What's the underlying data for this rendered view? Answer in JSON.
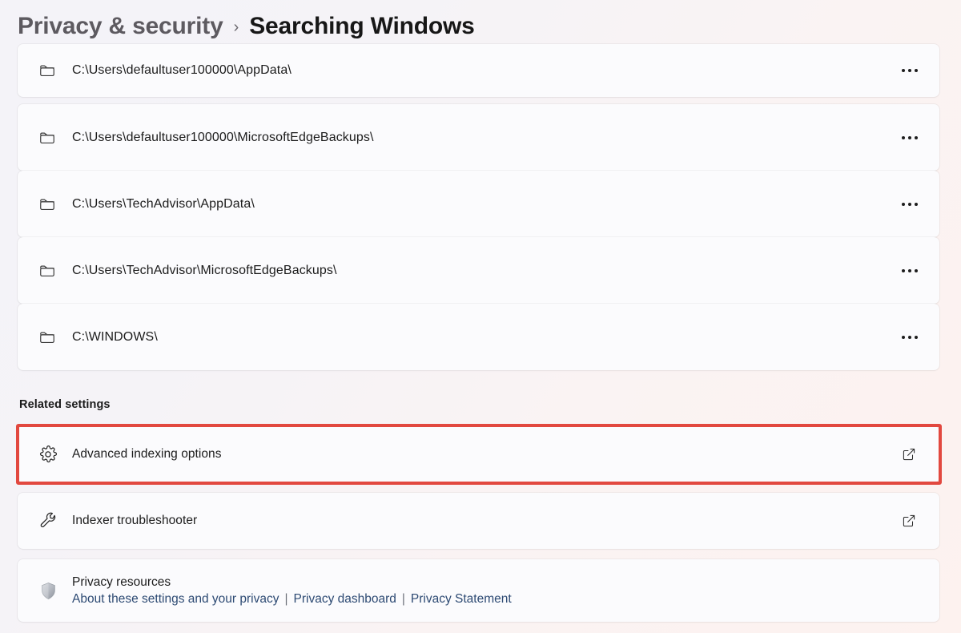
{
  "header": {
    "parent": "Privacy & security",
    "separator": "›",
    "current": "Searching Windows"
  },
  "excluded_folders": {
    "rows": [
      {
        "path": "C:\\Users\\defaultuser100000\\AppData\\",
        "icon": "folder-icon",
        "more_label": "•••"
      },
      {
        "path": "C:\\Users\\defaultuser100000\\MicrosoftEdgeBackups\\",
        "icon": "folder-icon",
        "more_label": "•••"
      },
      {
        "path": "C:\\Users\\TechAdvisor\\AppData\\",
        "icon": "folder-icon",
        "more_label": "•••"
      },
      {
        "path": "C:\\Users\\TechAdvisor\\MicrosoftEdgeBackups\\",
        "icon": "folder-icon",
        "more_label": "•••"
      },
      {
        "path": "C:\\WINDOWS\\",
        "icon": "folder-icon",
        "more_label": "•••"
      }
    ]
  },
  "related_settings": {
    "heading": "Related settings",
    "items": [
      {
        "label": "Advanced indexing options",
        "icon": "gear-icon",
        "external": true,
        "highlighted": true
      },
      {
        "label": "Indexer troubleshooter",
        "icon": "wrench-icon",
        "external": true,
        "highlighted": false
      }
    ]
  },
  "privacy_resources": {
    "icon": "shield-icon",
    "title": "Privacy resources",
    "links": [
      "About these settings and your privacy",
      "Privacy dashboard",
      "Privacy Statement"
    ],
    "link_separator": "|"
  },
  "colors": {
    "highlight_border": "#e2483f",
    "link": "#2d4a73",
    "card_background": "#fbfbfd",
    "page_background": "#f5f3f7"
  }
}
